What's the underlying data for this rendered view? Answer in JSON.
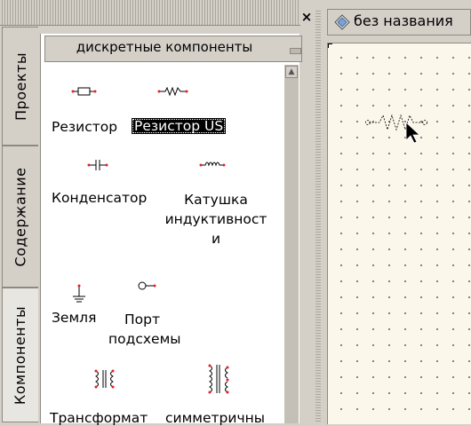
{
  "dock": {
    "close_glyph": "×",
    "tabs": [
      {
        "label": "Проекты",
        "active": false
      },
      {
        "label": "Содержание",
        "active": false
      },
      {
        "label": "Компоненты",
        "active": true
      }
    ],
    "category": {
      "title": "дискретные компоненты"
    },
    "components": [
      {
        "label": "Резистор",
        "icon": "resistor-icon",
        "selected": false
      },
      {
        "label": "Резистор US",
        "icon": "resistor-us-icon",
        "selected": true
      },
      {
        "label": "Конденсатор",
        "icon": "capacitor-icon",
        "selected": false
      },
      {
        "label_lines": [
          "Катушка",
          "индуктивност",
          "и"
        ],
        "icon": "inductor-icon",
        "selected": false
      },
      {
        "label": "Земля",
        "icon": "ground-icon",
        "selected": false
      },
      {
        "label_lines": [
          "Порт",
          "подсхемы"
        ],
        "icon": "subcircuit-port-icon",
        "selected": false
      },
      {
        "label": "Трансформат",
        "icon": "transformer-icon",
        "selected": false
      },
      {
        "label": "симметричны",
        "icon": "symmetric-transformer-icon",
        "selected": false
      }
    ]
  },
  "editor": {
    "tab_title": "без названия",
    "tab_icon": "document-icon"
  },
  "colors": {
    "canvas": "#fbf7ea",
    "pin": "#e0202a",
    "chrome": "#d4d0c8"
  }
}
